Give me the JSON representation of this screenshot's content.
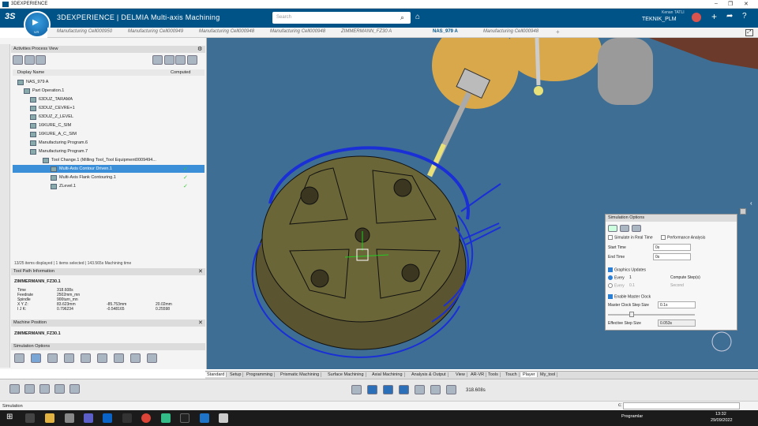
{
  "window": {
    "title": "3DEXPERIENCE"
  },
  "app": {
    "brand": "3DEXPERIENCE | DELMIA Multi-axis Machining",
    "search_placeholder": "Search",
    "user_name": "Kenan TATLI",
    "tenant": "TEKNIK_PLM",
    "compass_version": "V.R"
  },
  "tabs": [
    {
      "label": "Manufacturing Cell000950"
    },
    {
      "label": "Manufacturing Cell000949"
    },
    {
      "label": "Manufacturing Cell000948"
    },
    {
      "label": "Manufacturing Cell000948"
    },
    {
      "label": "ZIMMERMANN_FZ30 A"
    },
    {
      "label": "NAS_979 A"
    },
    {
      "label": "Manufacturing Cell000948"
    }
  ],
  "process_view": {
    "title": "Activities Process View",
    "columns": [
      "Display Name",
      "Computed"
    ],
    "root": "NAS_979 A",
    "items": [
      {
        "label": "Part Operation.1"
      },
      {
        "label": "63DUZ_TARAMA"
      },
      {
        "label": "63DUZ_CEVRE+1"
      },
      {
        "label": "63DUZ_Z_LEVEL"
      },
      {
        "label": "16KURE_C_SIM"
      },
      {
        "label": "16KURE_A_C_SIM"
      },
      {
        "label": "Manufacturing Program.6"
      },
      {
        "label": "Manufacturing Program.7"
      },
      {
        "label": "Tool Change.1 (Milling Tool_Tool Equipment0009494..."
      },
      {
        "label": "Multi-Axis Contour Driven.1"
      },
      {
        "label": "Multi-Axis Flank Contouring.1"
      },
      {
        "label": "ZLevel.1"
      }
    ],
    "status": "13/25 items displayed | 1 items selected | 143.565s Machining time"
  },
  "tool_path": {
    "title": "Tool Path Information",
    "machine": "ZIMMERMANN_FZ30.1",
    "time_label": "Time",
    "time": "318.608s",
    "feed_label": "Feedrate",
    "feed": "2502mm_mn",
    "spindle_label": "Spindle",
    "spindle": "900turn_mn",
    "xyz_label": "X Y Z:",
    "x": "83.623mm",
    "y": "-85.753mm",
    "z": "20.02mm",
    "ijk_label": "I J K:",
    "i": "0.796234",
    "j": "-0.548165",
    "k": "0.25598"
  },
  "machine_position": {
    "title": "Machine Position",
    "machine": "ZIMMERMANN_FZ30.1"
  },
  "sim_options_left": {
    "title": "Simulation Options"
  },
  "sim_options": {
    "title": "Simulation Options",
    "real_time": "Simulate in Real Time",
    "perf": "Performance Analysis",
    "start_label": "Start Time",
    "start": "0s",
    "end_label": "End Time",
    "end": "0s",
    "graphics": "Graphics Updates",
    "every_label": "Every",
    "every_val": "1",
    "every_unit": "Compute Step(s)",
    "every2_val": "0.1",
    "every2_unit": "Second",
    "master": "Enable Master Clock",
    "step_label": "Master Clock Step Size",
    "step": "0.1s",
    "eff_label": "Effective Step Size",
    "eff": "0.053s"
  },
  "bottom_tabs": [
    "Standard",
    "Setup",
    "Programming",
    "Prismatic Machining",
    "Surface Machining",
    "Axial Machining",
    "Analysis & Output",
    "View",
    "AR-VR",
    "Tools",
    "Touch",
    "Player",
    "My_tool"
  ],
  "player": {
    "time": "318.608s"
  },
  "status_bar": {
    "text": "Simulation"
  },
  "taskbar": {
    "lang": "Programlar",
    "time": "13:32",
    "date": "29/09/2022"
  },
  "colors": {
    "brand": "#005386",
    "viewport": "#3e6e94",
    "part": "#6b6637",
    "toolpath": "#1a2fd6",
    "selection": "#3a8fd8"
  }
}
